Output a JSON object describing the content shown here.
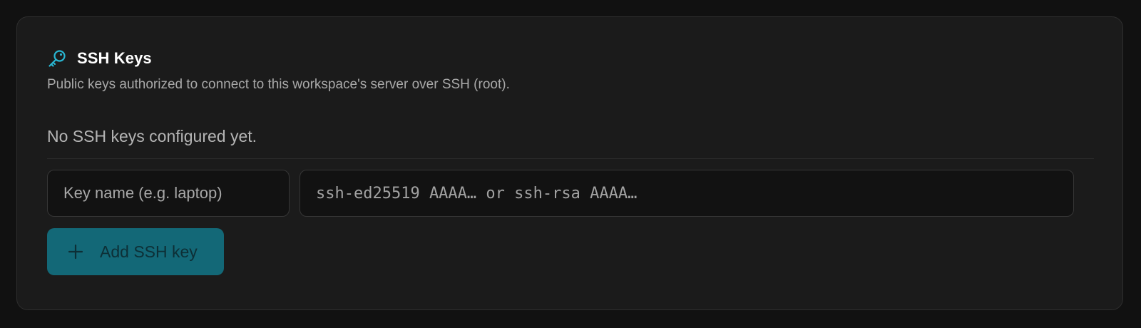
{
  "section": {
    "icon": "key-icon",
    "title": "SSH Keys",
    "description": "Public keys authorized to connect to this workspace's server over SSH (root).",
    "empty_message": "No SSH keys configured yet."
  },
  "form": {
    "name_placeholder": "Key name (e.g. laptop)",
    "key_placeholder": "ssh-ed25519 AAAA… or ssh-rsa AAAA…",
    "add_button_icon": "plus-icon",
    "add_button_label": "Add SSH key"
  },
  "colors": {
    "accent": "#29b6d2",
    "button_background": "#136877",
    "card_background": "#1b1b1b"
  }
}
